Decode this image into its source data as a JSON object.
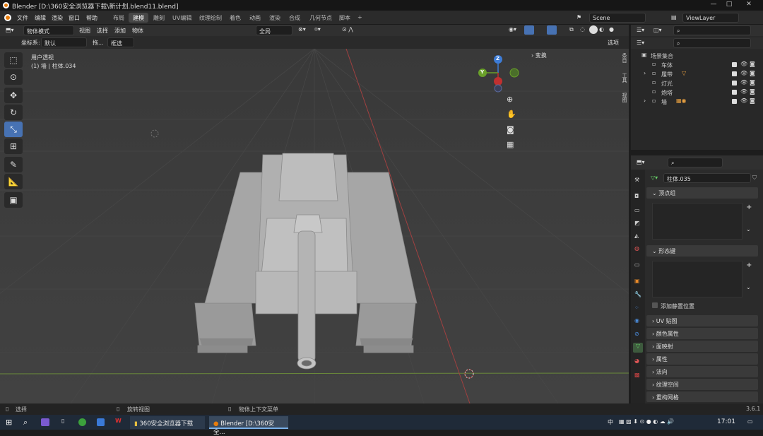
{
  "window": {
    "title": "Blender [D:\\360安全浏览器下载\\新计划.blend11.blend]",
    "min": "—",
    "max": "□",
    "close": "✕"
  },
  "menu": [
    "文件",
    "编辑",
    "渲染",
    "窗口",
    "帮助"
  ],
  "workspaces": [
    "布局",
    "建模",
    "雕刻",
    "UV编辑",
    "纹理绘制",
    "着色",
    "动画",
    "渲染",
    "合成",
    "几何节点",
    "脚本",
    "+"
  ],
  "active_workspace": "建模",
  "scene": {
    "name": "Scene",
    "viewlayer": "ViewLayer"
  },
  "header": {
    "mode": "物体模式",
    "view": "视图",
    "select": "选择",
    "add": "添加",
    "object": "物体",
    "orientation": "全局",
    "options": "选项"
  },
  "header2": {
    "coord_label": "坐标系:",
    "coord_value": "默认",
    "drag_label": "拖...",
    "select_mode": "框选"
  },
  "viewport": {
    "view_name": "用户透视",
    "selection": "(1) 墙 | 柱体.034",
    "transform_panel": "变换"
  },
  "gizmo": {
    "z": "Z",
    "y": "Y"
  },
  "side_tabs": [
    "条目",
    "工具",
    "视图"
  ],
  "outliner": {
    "root": "场景集合",
    "items": [
      {
        "name": "车体",
        "expand": false
      },
      {
        "name": "履带",
        "expand": true
      },
      {
        "name": "灯光",
        "expand": false
      },
      {
        "name": "炮塔",
        "expand": false
      },
      {
        "name": "墙",
        "expand": true
      }
    ]
  },
  "properties": {
    "object_name": "柱体.035",
    "panels": [
      "顶点组",
      "形态键",
      "UV 贴图",
      "颜色属性",
      "面映射",
      "属性",
      "法向",
      "纹理空间",
      "重构网格"
    ],
    "checkbox": "添加静置位置"
  },
  "status": {
    "select": "选择",
    "rotate": "旋转视图",
    "context": "物体上下文菜单",
    "version": "3.6.1"
  },
  "taskbar": {
    "app1": "360安全浏览器下载",
    "app2": "Blender [D:\\360安全...",
    "ime": "中",
    "time": "17:01"
  }
}
